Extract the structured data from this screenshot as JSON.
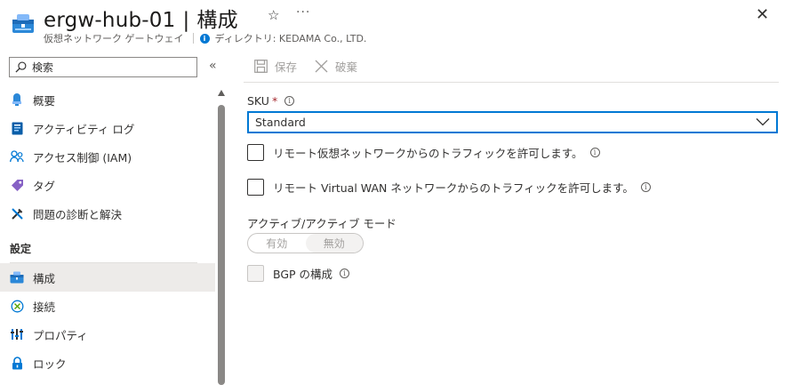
{
  "header": {
    "title": "ergw-hub-01",
    "separator": "|",
    "page": "構成",
    "resource_type": "仮想ネットワーク ゲートウェイ",
    "directory": "ディレクトリ: KEDAMA Co., LTD.",
    "icons": {
      "resource": "vpn-gateway-icon",
      "favorite": "star-icon",
      "more": "ellipsis-icon",
      "close": "close-icon",
      "info": "info-icon"
    },
    "star_glyph": "☆",
    "more_glyph": "···",
    "close_glyph": "✕",
    "info_glyph": "i"
  },
  "sidebar": {
    "search_placeholder": "検索",
    "collapse_glyph": "«",
    "items": [
      {
        "label": "概要",
        "icon": "overview-icon"
      },
      {
        "label": "アクティビティ ログ",
        "icon": "activity-log-icon"
      },
      {
        "label": "アクセス制御 (IAM)",
        "icon": "iam-icon"
      },
      {
        "label": "タグ",
        "icon": "tag-icon"
      },
      {
        "label": "問題の診断と解決",
        "icon": "diagnose-icon"
      }
    ],
    "section_label": "設定",
    "settings_items": [
      {
        "label": "構成",
        "icon": "configuration-icon",
        "active": true
      },
      {
        "label": "接続",
        "icon": "connections-icon"
      },
      {
        "label": "プロパティ",
        "icon": "properties-icon"
      },
      {
        "label": "ロック",
        "icon": "lock-icon"
      }
    ]
  },
  "toolbar": {
    "save_label": "保存",
    "discard_label": "破棄"
  },
  "form": {
    "sku_label": "SKU",
    "sku_required_mark": "*",
    "sku_value": "Standard",
    "remote_vnet_label": "リモート仮想ネットワークからのトラフィックを許可します。",
    "remote_vnet_checked": false,
    "remote_vwan_label": "リモート Virtual WAN ネットワークからのトラフィックを許可します。",
    "remote_vwan_checked": false,
    "active_active_label": "アクティブ/アクティブ モード",
    "active_active_on": "有効",
    "active_active_off": "無効",
    "active_active_selected": "無効",
    "bgp_label": "BGP の構成",
    "bgp_checked": false,
    "info_glyph": "i"
  },
  "colors": {
    "accent": "#0078d4",
    "required": "#a4262c",
    "disabled_text": "#a19f9d",
    "active_nav_bg": "#edebe9"
  }
}
